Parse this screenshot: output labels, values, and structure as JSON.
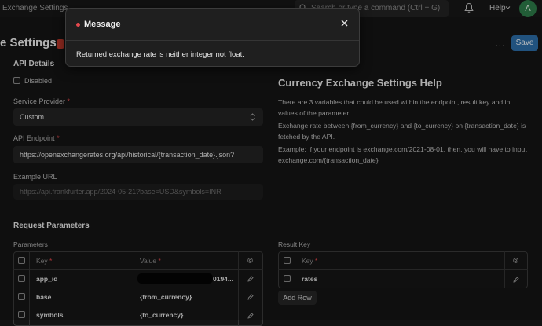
{
  "navbar": {
    "breadcrumb": "Exchange Settings",
    "search_placeholder": "Search or type a command (Ctrl + G)",
    "help_label": "Help",
    "avatar_initial": "A"
  },
  "page": {
    "title": "e Settings",
    "save_label": "Save",
    "more_label": "···"
  },
  "api_details": {
    "heading": "API Details",
    "disabled_label": "Disabled",
    "service_provider_label": "Service Provider",
    "service_provider_value": "Custom",
    "api_endpoint_label": "API Endpoint",
    "api_endpoint_value": "https://openexchangerates.org/api/historical/{transaction_date}.json?",
    "example_url_label": "Example URL",
    "example_url_value": "https://api.frankfurter.app/2024-05-21?base=USD&symbols=INR",
    "required_mark": "*"
  },
  "help": {
    "title": "Currency Exchange Settings Help",
    "p1": "There are 3 variables that could be used within the endpoint, result key and in values of the parameter.",
    "p2": "Exchange rate between {from_currency} and {to_currency} on {transaction_date} is fetched by the API.",
    "p3": "Example: If your endpoint is exchange.com/2021-08-01, then, you will have to input exchange.com/{transaction_date}"
  },
  "request_params": {
    "heading": "Request Parameters",
    "params_label": "Parameters",
    "result_key_label": "Result Key",
    "columns": {
      "key": "Key",
      "value": "Value"
    },
    "rows": [
      {
        "key": "app_id",
        "value": "0194..."
      },
      {
        "key": "base",
        "value": "{from_currency}"
      },
      {
        "key": "symbols",
        "value": "{to_currency}"
      }
    ],
    "result_rows": [
      {
        "key": "rates"
      }
    ],
    "add_row_label": "Add Row"
  },
  "modal": {
    "title": "Message",
    "body": "Returned exchange rate is neither integer not float."
  }
}
